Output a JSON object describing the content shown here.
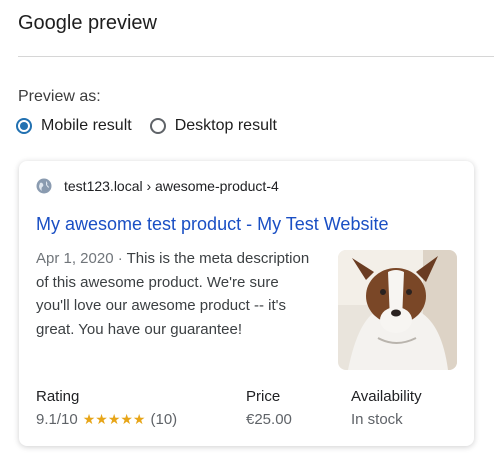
{
  "header": {
    "title": "Google preview"
  },
  "preview": {
    "label": "Preview as:",
    "options": [
      {
        "label": "Mobile result",
        "selected": true
      },
      {
        "label": "Desktop result",
        "selected": false
      }
    ]
  },
  "result": {
    "breadcrumb": "test123.local › awesome-product-4",
    "title": "My awesome test product - My Test Website",
    "date": "Apr 1, 2020",
    "separator": " · ",
    "description": "This is the meta description of this awesome product. We're sure you'll love our awesome product -- it's great. You have our guarantee!",
    "rating": {
      "heading": "Rating",
      "score": "9.1/10",
      "stars": "★★★★★",
      "count": "(10)"
    },
    "price": {
      "heading": "Price",
      "value": "€25.00"
    },
    "availability": {
      "heading": "Availability",
      "value": "In stock"
    }
  },
  "colors": {
    "accent": "#2271b1",
    "link": "#1a4fc4",
    "star": "#e7a518"
  }
}
